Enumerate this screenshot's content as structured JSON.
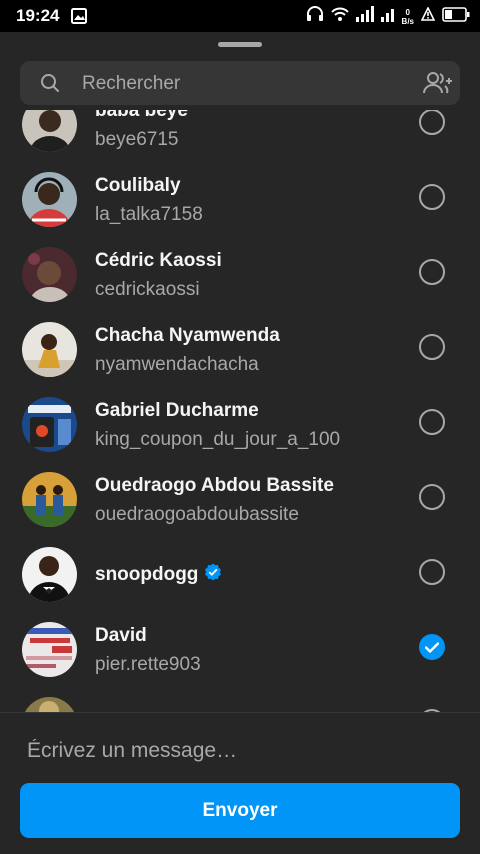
{
  "status_bar": {
    "time": "19:24",
    "speed_value": "0",
    "speed_unit": "B/s",
    "icons": [
      "gallery-icon",
      "headphones-icon",
      "wifi-icon",
      "signal-icon",
      "signal-icon",
      "alert-icon",
      "battery-icon"
    ]
  },
  "search": {
    "placeholder": "Rechercher"
  },
  "contacts": [
    {
      "name": "baba beye",
      "username": "beye6715",
      "selected": false
    },
    {
      "name": "Coulibaly",
      "username": "la_talka7158",
      "selected": false
    },
    {
      "name": "Cédric Kaossi",
      "username": "cedrickaossi",
      "selected": false
    },
    {
      "name": "Chacha Nyamwenda",
      "username": "nyamwendachacha",
      "selected": false
    },
    {
      "name": "Gabriel Ducharme",
      "username": "king_coupon_du_jour_a_100",
      "selected": false
    },
    {
      "name": "Ouedraogo Abdou Bassite",
      "username": "ouedraogoabdoubassite",
      "selected": false
    },
    {
      "name": "snoopdogg",
      "username": "",
      "verified": true,
      "selected": false
    },
    {
      "name": "David",
      "username": "pier.rette903",
      "selected": true
    }
  ],
  "composer": {
    "placeholder": "Écrivez un message…",
    "send_label": "Envoyer"
  },
  "colors": {
    "accent": "#0095f6",
    "background": "#262626",
    "secondary_text": "#a8a8a8"
  }
}
